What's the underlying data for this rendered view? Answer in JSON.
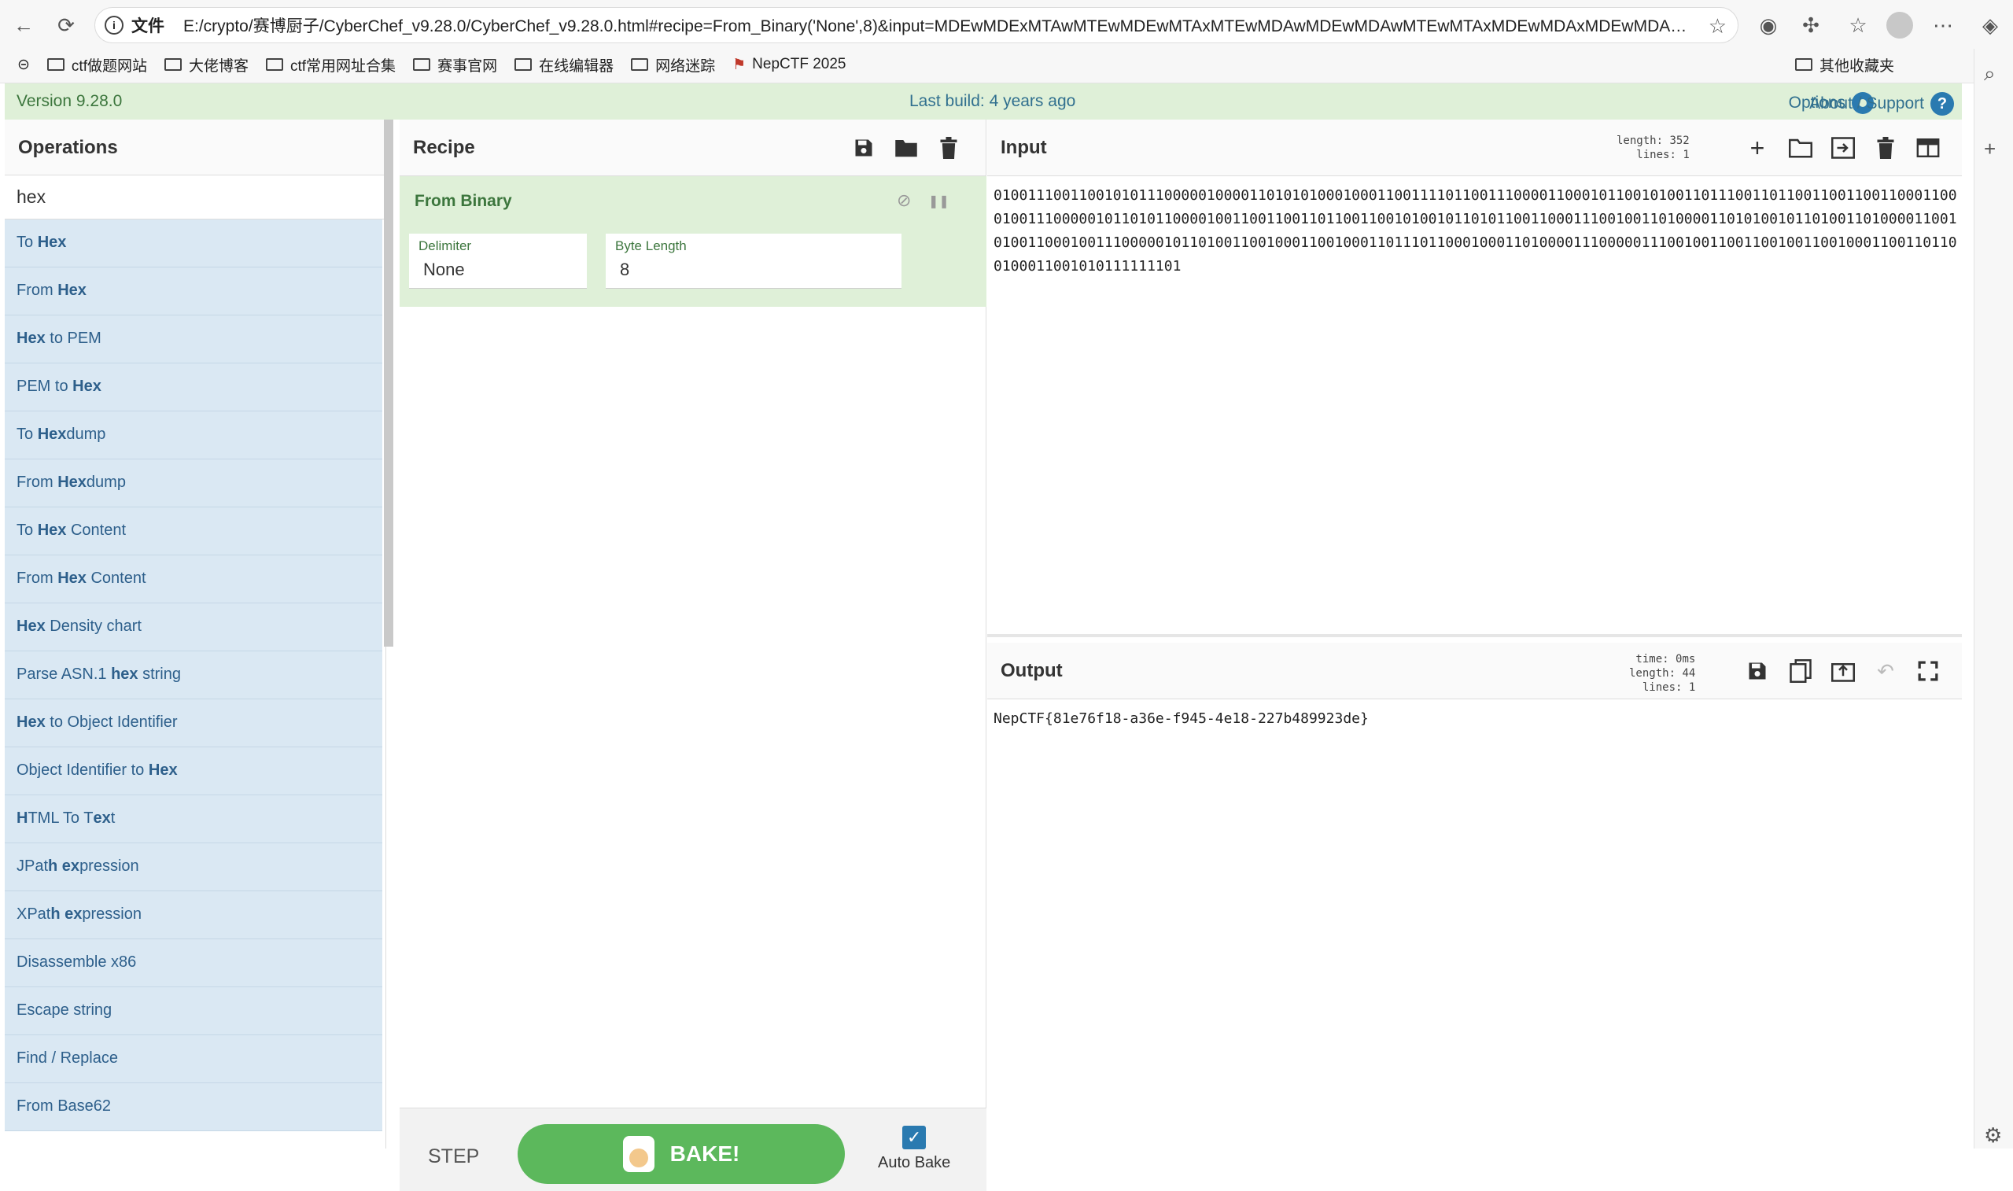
{
  "browser": {
    "back_icon": "←",
    "reload_icon": "⟳",
    "file_label": "文件",
    "url": "E:/crypto/赛博厨子/CyberChef_v9.28.0/CyberChef_v9.28.0.html#recipe=From_Binary('None',8)&input=MDEwMDExMTAwMTEwMDEwMTAxMTEwMDAwMDEwMDAwMTEwMTAxMDEwMDAxMDEwMDAxMDAwMTEwMDEx...",
    "bookmarks": [
      "ctf做题网站",
      "大佬博客",
      "ctf常用网址合集",
      "赛事官网",
      "在线编辑器",
      "网络迷踪",
      "NepCTF 2025"
    ],
    "other_bookmarks": "其他收藏夹"
  },
  "banner": {
    "version": "Version 9.28.0",
    "last_build": "Last build: 4 years ago",
    "options": "Options",
    "about": "About / Support",
    "help_icon": "?"
  },
  "operations": {
    "title": "Operations",
    "search_value": "hex",
    "items": [
      {
        "before": "To ",
        "bold": "Hex",
        "after": ""
      },
      {
        "before": "From ",
        "bold": "Hex",
        "after": ""
      },
      {
        "before": "",
        "bold": "Hex",
        "after": " to PEM"
      },
      {
        "before": "PEM to ",
        "bold": "Hex",
        "after": ""
      },
      {
        "before": "To ",
        "bold": "Hex",
        "after": "dump"
      },
      {
        "before": "From ",
        "bold": "Hex",
        "after": "dump"
      },
      {
        "before": "To ",
        "bold": "Hex",
        "after": " Content"
      },
      {
        "before": "From ",
        "bold": "Hex",
        "after": " Content"
      },
      {
        "before": "",
        "bold": "Hex",
        "after": " Density chart"
      },
      {
        "before": "Parse ASN.1 ",
        "bold": "hex",
        "after": " string"
      },
      {
        "before": "",
        "bold": "Hex",
        "after": " to Object Identifier"
      },
      {
        "before": "Object Identifier to ",
        "bold": "Hex",
        "after": ""
      },
      {
        "before": "",
        "bold": "H",
        "after": "TML To T",
        "bold2": "ex",
        "after2": "t"
      },
      {
        "before": "JPat",
        "bold": "h ex",
        "after": "pression"
      },
      {
        "before": "XPat",
        "bold": "h ex",
        "after": "pression"
      },
      {
        "before": "Disassemble x86",
        "bold": "",
        "after": ""
      },
      {
        "before": "Escape string",
        "bold": "",
        "after": ""
      },
      {
        "before": "Find / Replace",
        "bold": "",
        "after": ""
      },
      {
        "before": "From Base62",
        "bold": "",
        "after": ""
      }
    ]
  },
  "recipe": {
    "title": "Recipe",
    "operation": "From Binary",
    "disable_icon": "⃠",
    "pause_icon": "❚❚",
    "args": [
      {
        "label": "Delimiter",
        "value": "None"
      },
      {
        "label": "Byte Length",
        "value": "8"
      }
    ],
    "step_label": "STEP",
    "bake_label": "BAKE!",
    "auto_bake_label": "Auto Bake",
    "auto_bake_checked": true
  },
  "input": {
    "title": "Input",
    "length_label": "length:",
    "length": "352",
    "lines_label": "lines:",
    "lines": "1",
    "text": "0100111001100101011100000100001101010100010001100111101100111000011000101100101001101110011011001100110011000110001001110000010110101100001001100110011011001100101001011010110011000111001001101000011010100101101001101000011001010011000100111000001011010011001000110010001101110110001000110100001110000011100100110011001001100100011001101100100011001010111111101"
  },
  "output": {
    "title": "Output",
    "time_label": "time:",
    "time": "0ms",
    "length_label": "length:",
    "length": "44",
    "lines_label": "lines:",
    "lines": "1",
    "text": "NepCTF{81e76f18-a36e-f945-4e18-227b489923de}"
  }
}
